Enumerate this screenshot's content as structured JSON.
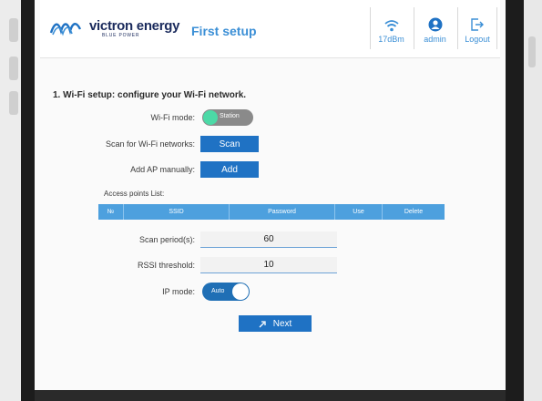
{
  "brand": {
    "name": "victron energy",
    "tagline": "BLUE POWER"
  },
  "header": {
    "title": "First setup",
    "wifi_label": "17dBm",
    "user_label": "admin",
    "logout_label": "Logout"
  },
  "setup": {
    "section_title": "1. Wi-Fi setup: configure your Wi-Fi network.",
    "wifi_mode_label": "Wi-Fi mode:",
    "wifi_mode_value": "Station",
    "scan_label": "Scan for Wi-Fi networks:",
    "scan_button": "Scan",
    "add_ap_label": "Add AP manually:",
    "add_button": "Add",
    "ap_list_title": "Access points List:",
    "ap_columns": [
      "№",
      "SSID",
      "Password",
      "Use",
      "Delete"
    ],
    "scan_period_label": "Scan period(s):",
    "scan_period_value": "60",
    "rssi_label": "RSSI threshold:",
    "rssi_value": "10",
    "ip_mode_label": "IP mode:",
    "ip_mode_value": "Auto",
    "next_button": "Next"
  },
  "colors": {
    "accent": "#3b8fd6",
    "button": "#1f72c4",
    "table_header": "#4da0de",
    "station_knob": "#4cd9a6"
  }
}
